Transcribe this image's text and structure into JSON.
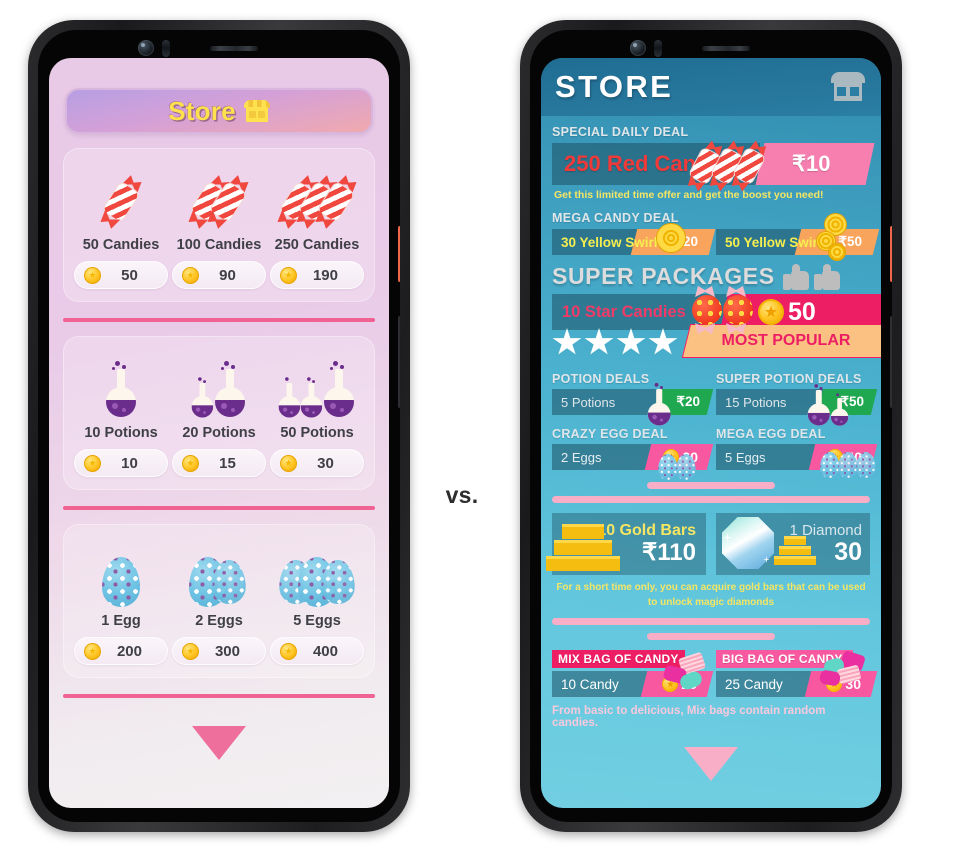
{
  "comparison": {
    "vs_label": "vs."
  },
  "left_phone": {
    "name": "pink-store-screen",
    "title": {
      "text": "Store",
      "icon": "shop-icon"
    },
    "sections": [
      {
        "id": "candies",
        "items": [
          {
            "art": "candy",
            "count": 1,
            "name": "50 Candies",
            "price": "50",
            "coin": "coin-icon"
          },
          {
            "art": "candy",
            "count": 2,
            "name": "100 Candies",
            "price": "90",
            "coin": "coin-icon"
          },
          {
            "art": "candy",
            "count": 3,
            "name": "250 Candies",
            "price": "190",
            "coin": "coin-icon"
          }
        ]
      },
      {
        "id": "potions",
        "items": [
          {
            "art": "potion",
            "count": 1,
            "name": "10 Potions",
            "price": "10",
            "coin": "coin-icon"
          },
          {
            "art": "potion",
            "count": 2,
            "name": "20 Potions",
            "price": "15",
            "coin": "coin-icon"
          },
          {
            "art": "potion",
            "count": 3,
            "name": "50 Potions",
            "price": "30",
            "coin": "coin-icon"
          }
        ]
      },
      {
        "id": "eggs",
        "items": [
          {
            "art": "egg",
            "count": 1,
            "name": "1 Egg",
            "price": "200",
            "coin": "coin-icon"
          },
          {
            "art": "egg",
            "count": 2,
            "name": "2 Eggs",
            "price": "300",
            "coin": "coin-icon"
          },
          {
            "art": "egg",
            "count": 3,
            "name": "5 Eggs",
            "price": "400",
            "coin": "coin-icon"
          }
        ]
      }
    ],
    "scroll_indicator": "triangle-down-icon"
  },
  "right_phone": {
    "name": "teal-store-screen",
    "header": {
      "title": "STORE",
      "icon": "shop-icon"
    },
    "special_daily_deal": {
      "label": "SPECIAL DAILY DEAL",
      "item": "250 Red Candy",
      "price": "₹10",
      "note": "Get this limited time offer and get the boost you need!"
    },
    "mega_candy_deal": {
      "label": "MEGA CANDY DEAL",
      "offers": [
        {
          "item": "30 Yellow Swirls",
          "price": "₹20"
        },
        {
          "item": "50 Yellow Swirls",
          "price": "₹50"
        }
      ]
    },
    "super_packages": {
      "label": "SUPER PACKAGES",
      "featured": {
        "item": "10 Star Candies",
        "price": "50",
        "badge": "MOST POPULAR",
        "stars": 4
      }
    },
    "potion_deals": [
      {
        "label": "POTION DEALS",
        "item": "5 Potions",
        "price": "₹20"
      },
      {
        "label": "SUPER POTION DEALS",
        "item": "15 Potions",
        "price": "₹50"
      }
    ],
    "egg_deals": [
      {
        "label": "CRAZY EGG DEAL",
        "item": "2 Eggs",
        "price": "20"
      },
      {
        "label": "MEGA EGG DEAL",
        "item": "5 Eggs",
        "price": "40"
      }
    ],
    "premium": {
      "gold": {
        "title": "10 Gold Bars",
        "price": "₹110"
      },
      "diamond": {
        "title": "1 Diamond",
        "price": "30"
      },
      "note": "For a short time only, you can acquire gold bars that can be used to unlock  magic diamonds"
    },
    "mix_bags": {
      "offers": [
        {
          "title": "MIX BAG OF CANDY",
          "item": "10 Candy",
          "price": "20"
        },
        {
          "title": "BIG BAG OF CANDY!",
          "item": "25 Candy",
          "price": "30"
        }
      ],
      "note": "From basic to delicious, Mix bags contain random candies."
    },
    "scroll_indicator": "triangle-down-icon"
  },
  "colors": {
    "pink_accent": "#f06292",
    "teal_bg": "#4bb2cf",
    "teal_header": "#27769c",
    "gold": "#ffc423",
    "hot_pink": "#ed1e63",
    "yellow_text": "#f5e663"
  }
}
